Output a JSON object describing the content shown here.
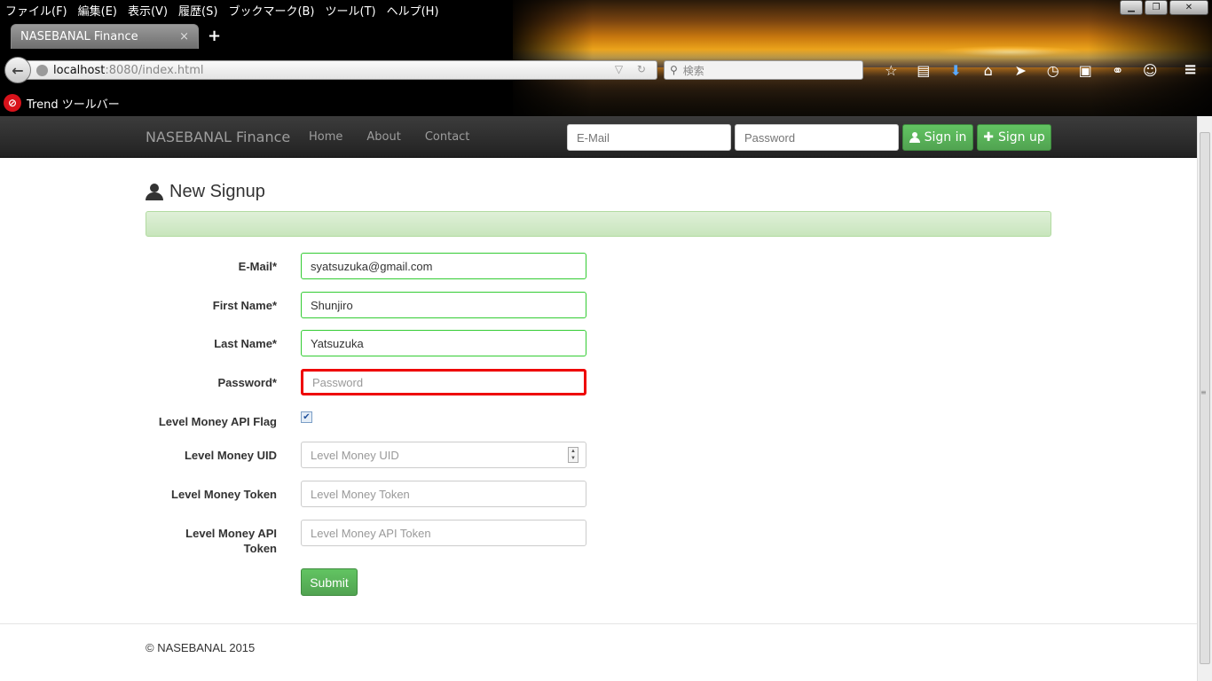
{
  "browser": {
    "menu": [
      "ファイル(F)",
      "編集(E)",
      "表示(V)",
      "履歴(S)",
      "ブックマーク(B)",
      "ツール(T)",
      "ヘルプ(H)"
    ],
    "tab_title": "NASEBANAL Finance",
    "tab_close": "×",
    "new_tab": "+",
    "url_host": "localhost",
    "url_rest": ":8080/index.html",
    "search_placeholder": "検索",
    "trend_label": "Trend ツールバー",
    "window_controls": [
      "minimize-icon",
      "restore-icon",
      "close-icon"
    ],
    "toolbar_icons": [
      "star-icon",
      "reader-icon",
      "download-icon",
      "home-icon",
      "send-icon",
      "clock-icon",
      "sql-icon",
      "link-icon",
      "chevron-down-icon",
      "smiley-icon"
    ]
  },
  "site": {
    "brand": "NASEBANAL Finance",
    "nav": [
      "Home",
      "About",
      "Contact"
    ],
    "login_email_placeholder": "E-Mail",
    "login_password_placeholder": "Password",
    "signin_label": "Sign in",
    "signup_label": "Sign up"
  },
  "form": {
    "heading": "New Signup",
    "fields": {
      "email": {
        "label": "E-Mail*",
        "value": "syatsuzuka@gmail.com"
      },
      "first_name": {
        "label": "First Name*",
        "value": "Shunjiro"
      },
      "last_name": {
        "label": "Last Name*",
        "value": "Yatsuzuka"
      },
      "password": {
        "label": "Password*",
        "placeholder": "Password"
      },
      "api_flag": {
        "label": "Level Money API Flag",
        "checked": true
      },
      "uid": {
        "label": "Level Money UID",
        "placeholder": "Level Money UID"
      },
      "token": {
        "label": "Level Money Token",
        "placeholder": "Level Money Token"
      },
      "api_token": {
        "label_line1": "Level Money API",
        "label_line2": "Token",
        "placeholder": "Level Money API Token"
      }
    },
    "submit_label": "Submit"
  },
  "footer": {
    "text": "© NASEBANAL 2015"
  },
  "colors": {
    "success": "#5cb85c",
    "error": "#e00000",
    "navbar": "#222222"
  }
}
